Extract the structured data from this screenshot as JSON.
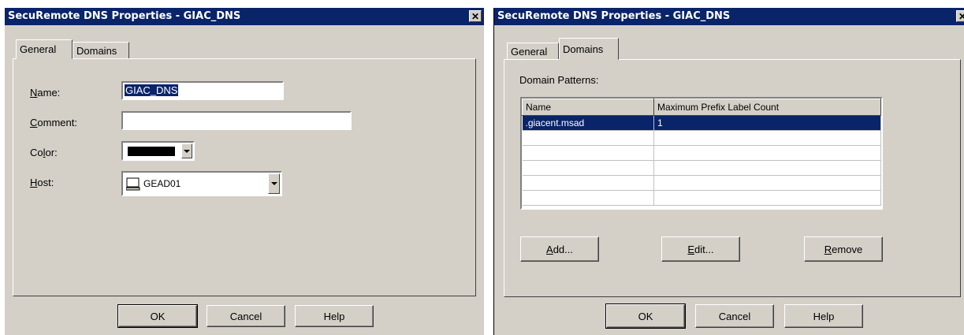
{
  "left_dialog": {
    "title": "SecuRemote DNS Properties - GIAC_DNS",
    "close_glyph": "✕",
    "tabs": [
      "General",
      "Domains"
    ],
    "name_label_accel": "N",
    "name_label_rest": "ame:",
    "name_value": "GIAC_DNS",
    "comment_label_accel": "C",
    "comment_label_rest": "omment:",
    "comment_value": "",
    "color_label_pre": "Co",
    "color_label_accel": "l",
    "color_label_rest": "or:",
    "color_value": "#000000",
    "host_label_accel": "H",
    "host_label_rest": "ost:",
    "host_value": "GEAD01",
    "host_icon": "computer-icon",
    "ok_label": "OK",
    "cancel_label": "Cancel",
    "help_label": "Help"
  },
  "right_dialog": {
    "title": "SecuRemote DNS Properties - GIAC_DNS",
    "close_glyph": "✕",
    "tabs": [
      "General",
      "Domains"
    ],
    "domain_patterns_label": "Domain Patterns:",
    "columns": [
      "Name",
      "Maximum Prefix Label Count"
    ],
    "rows": [
      {
        "name": ".giacent.msad",
        "count": "1"
      }
    ],
    "add_accel": "A",
    "add_rest": "dd...",
    "edit_accel": "E",
    "edit_rest": "dit...",
    "remove_accel": "R",
    "remove_rest": "emove",
    "ok_label": "OK",
    "cancel_label": "Cancel",
    "help_label": "Help"
  },
  "colors": {
    "titlebar": "#0a246a",
    "face": "#d4d0c8",
    "selection": "#0a246a"
  }
}
